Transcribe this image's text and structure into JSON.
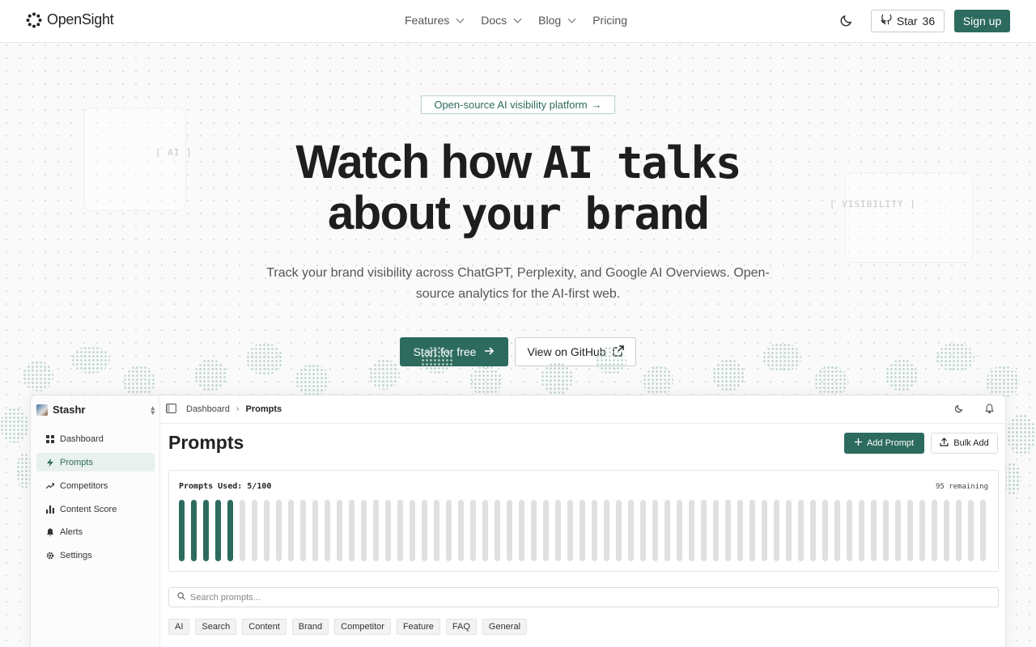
{
  "nav": {
    "brand": "OpenSight",
    "links": [
      {
        "label": "Features",
        "dropdown": true
      },
      {
        "label": "Docs",
        "dropdown": true
      },
      {
        "label": "Blog",
        "dropdown": true
      },
      {
        "label": "Pricing",
        "dropdown": false
      }
    ],
    "theme_icon": "moon-icon",
    "star_label": "Star",
    "star_count": "36",
    "signup_label": "Sign up"
  },
  "hero": {
    "badge": "Open-source AI visibility platform",
    "badge_arrow": "→",
    "deco_left": "[ AI ]",
    "deco_right": "[ VISIBILITY ]",
    "headline_line1_a": "Watch how ",
    "headline_line1_b": "AI talks",
    "headline_line2_a": "about ",
    "headline_line2_b": "your brand",
    "subtext": "Track your brand visibility across ChatGPT, Perplexity, and Google AI Overviews. Open-source analytics for the AI-first web.",
    "cta_primary": "Start for free",
    "cta_primary_icon": "arrow-right-icon",
    "cta_secondary": "View on GitHub",
    "cta_secondary_icon": "external-link-icon"
  },
  "app": {
    "workspace": "Stashr",
    "sidebar": [
      {
        "label": "Dashboard",
        "icon": "grid-icon",
        "active": false
      },
      {
        "label": "Prompts",
        "icon": "lightning-icon",
        "active": true
      },
      {
        "label": "Competitors",
        "icon": "trend-icon",
        "active": false
      },
      {
        "label": "Content Score",
        "icon": "bar-chart-icon",
        "active": false
      },
      {
        "label": "Alerts",
        "icon": "bell-icon",
        "active": false
      },
      {
        "label": "Settings",
        "icon": "gear-icon",
        "active": false
      }
    ],
    "breadcrumb": {
      "parent": "Dashboard",
      "current": "Prompts"
    },
    "page_title": "Prompts",
    "add_button": "Add Prompt",
    "bulk_button": "Bulk Add",
    "usage": {
      "label": "Prompts Used: 5/100",
      "used": 5,
      "total": 100,
      "remaining": "95 remaining"
    },
    "search_placeholder": "Search prompts...",
    "tags": [
      "AI",
      "Search",
      "Content",
      "Brand",
      "Competitor",
      "Feature",
      "FAQ",
      "General"
    ]
  },
  "colors": {
    "accent": "#2d6b5e",
    "accent_light": "#e8f1ee",
    "bar_empty": "#e0e0e0"
  }
}
